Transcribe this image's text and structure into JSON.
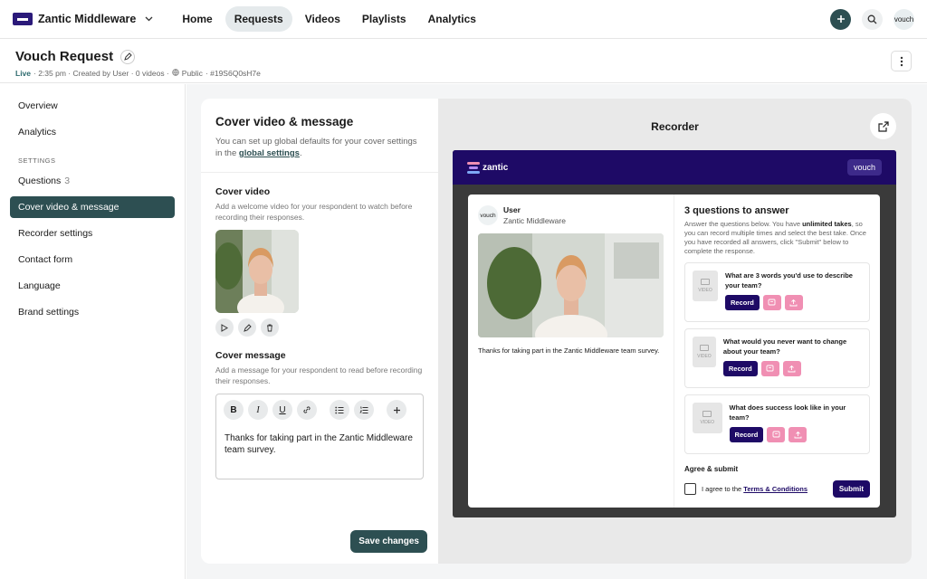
{
  "nav": {
    "org_name": "Zantic Middleware",
    "links": [
      "Home",
      "Requests",
      "Videos",
      "Playlists",
      "Analytics"
    ],
    "active": "Requests",
    "avatar_text": "vouch"
  },
  "header": {
    "title": "Vouch Request",
    "status": "Live",
    "meta": [
      " · 2:35 pm · Created by User · 0 videos · ",
      "Public",
      " · #19S6Q0sH7e"
    ]
  },
  "sidebar": {
    "items_top": [
      "Overview",
      "Analytics"
    ],
    "section_label": "SETTINGS",
    "questions_label": "Questions",
    "questions_count": "3",
    "items": [
      "Cover video & message",
      "Recorder settings",
      "Contact form",
      "Language",
      "Brand settings"
    ]
  },
  "editor": {
    "title": "Cover video & message",
    "desc_prefix": "You can set up global defaults for your cover settings in the ",
    "desc_link": "global settings",
    "desc_suffix": ".",
    "cover_video_title": "Cover video",
    "cover_video_desc": "Add a welcome video for your respondent to watch before recording their responses.",
    "cover_message_title": "Cover message",
    "cover_message_desc": "Add a message for your respondent to read before recording their responses.",
    "message_text": "Thanks for taking part in the Zantic Middleware team survey.",
    "toolbar": [
      "B",
      "I",
      "U"
    ],
    "save_label": "Save changes"
  },
  "recorder": {
    "title": "Recorder",
    "brand": "zantic",
    "vouch_chip": "vouch",
    "user_avatar": "vouch",
    "user_name": "User",
    "user_org": "Zantic Middleware",
    "thanks_text": "Thanks for taking part in the Zantic Middleware team survey.",
    "questions_title": "3 questions to answer",
    "desc_a": "Answer the questions below. You have ",
    "desc_b": "unlimited takes",
    "desc_c": ", so you can record multiple times and select the best take. Once you have recorded all answers, click \"Submit\" below to complete the response.",
    "video_label": "VIDEO",
    "record_label": "Record",
    "questions": [
      "What are 3 words you'd use to describe your team?",
      "What would you never want to change about your team?",
      "What does success look like in your team?"
    ],
    "agree_title": "Agree & submit",
    "agree_prefix": "I agree to the ",
    "agree_link": "Terms & Conditions",
    "submit_label": "Submit"
  },
  "colors": {
    "accent": "#2d4f52",
    "brand_dark": "#1e0a66",
    "pink": "#f08fb3"
  }
}
